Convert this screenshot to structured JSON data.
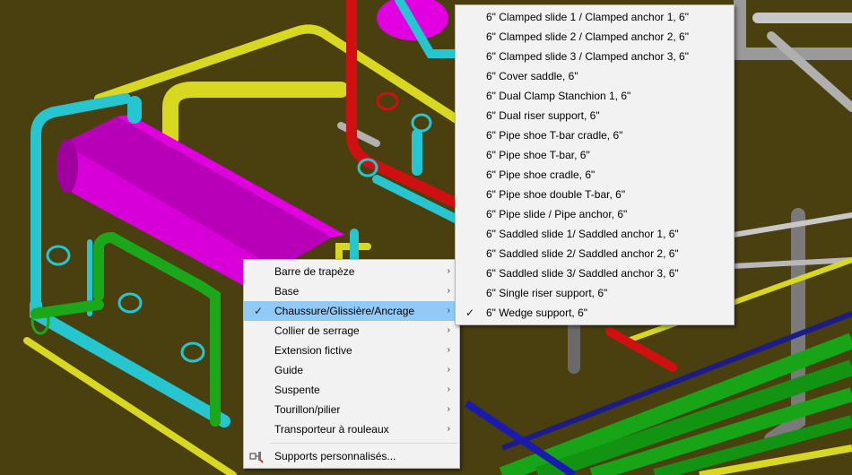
{
  "colors": {
    "background": "#4a3f0f",
    "vessel": "#e000e0",
    "pipe_cyan": "#26c6d0",
    "pipe_yellow": "#d8d820",
    "pipe_red": "#d01010",
    "pipe_green": "#1aa81a",
    "pipe_gray": "#8a8a8a",
    "menu_bg": "#f2f2f2",
    "menu_selected": "#91c9f7"
  },
  "context_menu": {
    "items": [
      {
        "label": "Barre de trapèze",
        "has_submenu": true,
        "checked": false
      },
      {
        "label": "Base",
        "has_submenu": true,
        "checked": false
      },
      {
        "label": "Chaussure/Glissière/Ancrage",
        "has_submenu": true,
        "checked": true,
        "selected": true
      },
      {
        "label": "Collier de serrage",
        "has_submenu": true,
        "checked": false
      },
      {
        "label": "Extension fictive",
        "has_submenu": true,
        "checked": false
      },
      {
        "label": "Guide",
        "has_submenu": true,
        "checked": false
      },
      {
        "label": "Suspente",
        "has_submenu": true,
        "checked": false
      },
      {
        "label": "Tourillon/pilier",
        "has_submenu": true,
        "checked": false
      },
      {
        "label": "Transporteur à rouleaux",
        "has_submenu": true,
        "checked": false
      }
    ],
    "custom_item": {
      "label": "Supports personnalisés...",
      "icon": "custom-supports-icon"
    }
  },
  "submenu": {
    "items": [
      {
        "label": "6\" Clamped slide 1 / Clamped anchor 1, 6\"",
        "checked": false
      },
      {
        "label": "6\" Clamped slide 2 / Clamped anchor 2, 6\"",
        "checked": false
      },
      {
        "label": "6\" Clamped slide 3 / Clamped anchor 3, 6\"",
        "checked": false
      },
      {
        "label": "6\" Cover saddle, 6\"",
        "checked": false
      },
      {
        "label": "6\" Dual Clamp Stanchion 1, 6\"",
        "checked": false
      },
      {
        "label": "6\" Dual riser support, 6\"",
        "checked": false
      },
      {
        "label": "6\" Pipe shoe T-bar cradle, 6\"",
        "checked": false
      },
      {
        "label": "6\" Pipe shoe T-bar, 6\"",
        "checked": false
      },
      {
        "label": "6\" Pipe shoe cradle, 6\"",
        "checked": false
      },
      {
        "label": "6\" Pipe shoe double T-bar, 6\"",
        "checked": false
      },
      {
        "label": "6\" Pipe slide / Pipe anchor, 6\"",
        "checked": false
      },
      {
        "label": "6\" Saddled slide 1/ Saddled anchor 1, 6\"",
        "checked": false
      },
      {
        "label": "6\" Saddled slide 2/ Saddled anchor 2, 6\"",
        "checked": false
      },
      {
        "label": "6\" Saddled slide 3/ Saddled anchor 3, 6\"",
        "checked": false
      },
      {
        "label": "6\" Single riser support, 6\"",
        "checked": false
      },
      {
        "label": "6\" Wedge support, 6\"",
        "checked": true
      }
    ]
  },
  "glyphs": {
    "check": "✓",
    "submenu_arrow": "›"
  }
}
